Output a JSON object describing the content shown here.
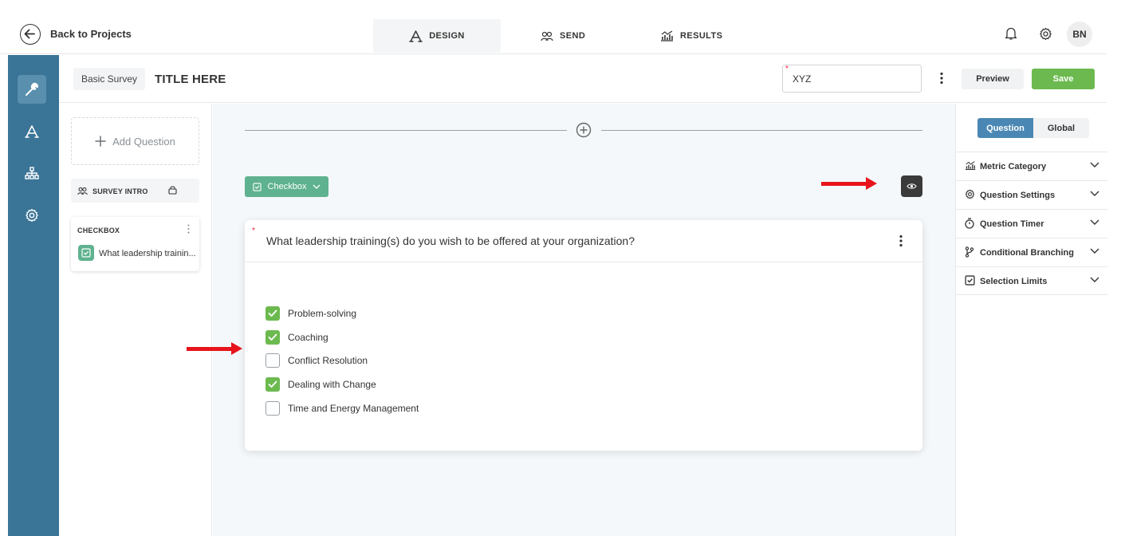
{
  "topbar": {
    "back_label": "Back to Projects",
    "tabs": [
      {
        "label": "DESIGN",
        "icon": "design-icon",
        "active": true
      },
      {
        "label": "SEND",
        "icon": "users-icon",
        "active": false
      },
      {
        "label": "RESULTS",
        "icon": "results-chart-icon",
        "active": false
      }
    ],
    "avatar_initials": "BN"
  },
  "rail": {
    "items": [
      {
        "icon": "wrench-icon",
        "active": true
      },
      {
        "icon": "design-icon",
        "active": false
      },
      {
        "icon": "sitemap-icon",
        "active": false
      },
      {
        "icon": "gear-icon",
        "active": false
      }
    ]
  },
  "header": {
    "survey_type": "Basic Survey",
    "title": "TITLE HERE",
    "name_value": "XYZ",
    "preview_label": "Preview",
    "save_label": "Save"
  },
  "left_panel": {
    "add_question_label": "Add Question",
    "intro_label": "SURVEY INTRO",
    "question_card": {
      "type_label": "CHECKBOX",
      "text": "What leadership trainin..."
    }
  },
  "canvas": {
    "type_pill_label": "Checkbox",
    "question": "What leadership training(s) do you wish to be offered at your organization?",
    "options": [
      {
        "label": "Problem-solving",
        "checked": true
      },
      {
        "label": "Coaching",
        "checked": true
      },
      {
        "label": "Conflict Resolution",
        "checked": false
      },
      {
        "label": "Dealing with Change",
        "checked": true
      },
      {
        "label": "Time and Energy Management",
        "checked": false
      }
    ]
  },
  "right_panel": {
    "tab_question": "Question",
    "tab_global": "Global",
    "sections": [
      {
        "label": "Metric Category",
        "icon": "metric-chart-icon"
      },
      {
        "label": "Question Settings",
        "icon": "gear-icon"
      },
      {
        "label": "Question Timer",
        "icon": "timer-icon"
      },
      {
        "label": "Conditional Branching",
        "icon": "branch-icon"
      },
      {
        "label": "Selection Limits",
        "icon": "checkbox-icon"
      }
    ]
  },
  "colors": {
    "rail": "#3a7496",
    "accent_green": "#6cba4f",
    "pill_green": "#5fb28f",
    "tab_blue": "#4a87b4",
    "annotation_red": "#e8141b"
  }
}
